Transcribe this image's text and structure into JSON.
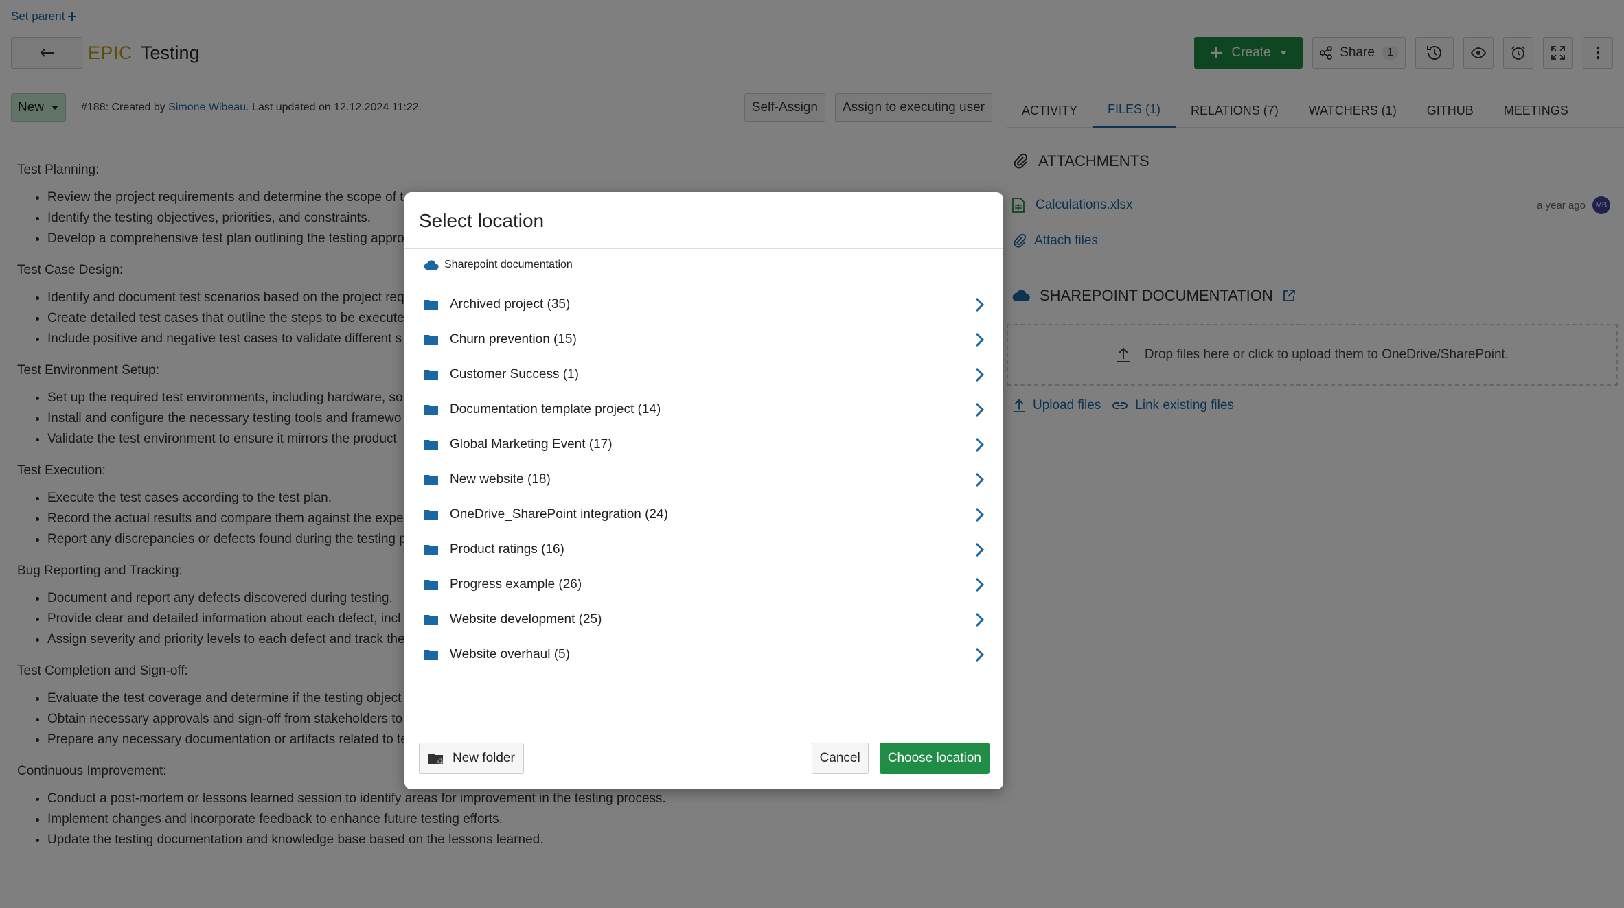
{
  "header": {
    "set_parent": "Set parent",
    "type_label": "EPIC",
    "subject": "Testing",
    "create_label": "Create",
    "share_label": "Share",
    "share_count": "1"
  },
  "status": {
    "state": "New",
    "meta_prefix": "#188: Created by ",
    "author": "Simone Wibeau",
    "meta_suffix": ". Last updated on 12.12.2024 11:22.",
    "self_assign": "Self-Assign",
    "assign_exec": "Assign to executing user"
  },
  "description": {
    "sections": [
      {
        "title": "Test Planning:",
        "items": [
          "Review the project requirements and determine the scope of t",
          "Identify the testing objectives, priorities, and constraints.",
          "Develop a comprehensive test plan outlining the testing appro"
        ]
      },
      {
        "title": "Test Case Design:",
        "items": [
          "Identify and document test scenarios based on the project req",
          "Create detailed test cases that outline the steps to be execute",
          "Include positive and negative test cases to validate different s"
        ]
      },
      {
        "title": "Test Environment Setup:",
        "items": [
          "Set up the required test environments, including hardware, so",
          "Install and configure the necessary testing tools and framewo",
          "Validate the test environment to ensure it mirrors the product"
        ]
      },
      {
        "title": "Test Execution:",
        "items": [
          "Execute the test cases according to the test plan.",
          "Record the actual results and compare them against the expe",
          "Report any discrepancies or defects found during the testing p"
        ]
      },
      {
        "title": "Bug Reporting and Tracking:",
        "items": [
          "Document and report any defects discovered during testing.",
          "Provide clear and detailed information about each defect, incl",
          "Assign severity and priority levels to each defect and track the"
        ]
      },
      {
        "title": "Test Completion and Sign-off:",
        "items": [
          "Evaluate the test coverage and determine if the testing object",
          "Obtain necessary approvals and sign-off from stakeholders to",
          "Prepare any necessary documentation or artifacts related to te"
        ]
      },
      {
        "title": "Continuous Improvement:",
        "items": [
          "Conduct a post-mortem or lessons learned session to identify areas for improvement in the testing process.",
          "Implement changes and incorporate feedback to enhance future testing efforts.",
          "Update the testing documentation and knowledge base based on the lessons learned."
        ]
      }
    ]
  },
  "tabs": [
    {
      "label": "Activity"
    },
    {
      "label": "Files (1)"
    },
    {
      "label": "Relations (7)"
    },
    {
      "label": "Watchers (1)"
    },
    {
      "label": "GitHub"
    },
    {
      "label": "Meetings"
    }
  ],
  "attachments": {
    "heading": "Attachments",
    "file_name": "Calculations.xlsx",
    "file_age": "a year ago",
    "avatar_initials": "MB",
    "attach_files": "Attach files"
  },
  "sharepoint": {
    "heading": "SharePoint Documentation",
    "dropzone": "Drop files here or click to upload them to OneDrive/SharePoint.",
    "upload": "Upload files",
    "link_existing": "Link existing files"
  },
  "modal": {
    "title": "Select location",
    "crumb": "Sharepoint documentation",
    "folders": [
      "Archived project (35)",
      "Churn prevention (15)",
      "Customer Success (1)",
      "Documentation template project (14)",
      "Global Marketing Event (17)",
      "New website (18)",
      "OneDrive_SharePoint integration (24)",
      "Product ratings (16)",
      "Progress example (26)",
      "Website development (25)",
      "Website overhaul (5)"
    ],
    "new_folder": "New folder",
    "cancel": "Cancel",
    "choose": "Choose location"
  },
  "colors": {
    "accent": "#1a67a3",
    "primary_button": "#1f8d45",
    "epic": "#c09b17",
    "status_new": "#c4e8cf"
  }
}
